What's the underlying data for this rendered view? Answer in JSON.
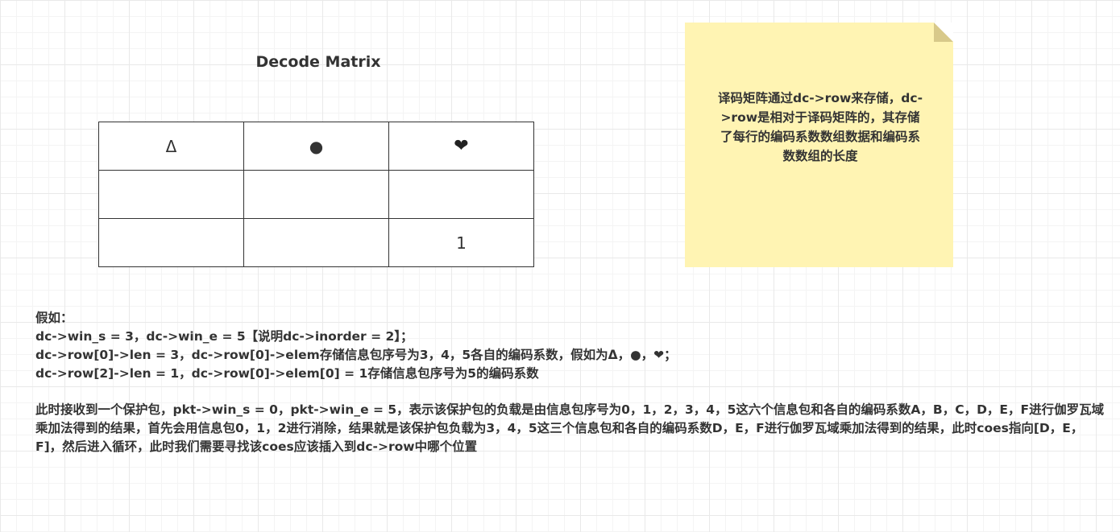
{
  "title": "Decode Matrix",
  "matrix": {
    "rows": [
      [
        "Δ",
        "●",
        "❤"
      ],
      [
        "",
        "",
        ""
      ],
      [
        "",
        "",
        "1"
      ]
    ]
  },
  "note": {
    "text": "译码矩阵通过dc->row来存储，dc->row是相对于译码矩阵的，其存储了每行的编码系数数组数据和编码系数数组的长度"
  },
  "body": {
    "line1": "假如：",
    "line2": "dc->win_s = 3，dc->win_e = 5【说明dc->inorder = 2】；",
    "line3": "dc->row[0]->len = 3，dc->row[0]->elem存储信息包序号为3，4，5各自的编码系数，假如为Δ，●，❤；",
    "line4": "dc->row[2]->len = 1，dc->row[0]->elem[0] = 1存储信息包序号为5的编码系数",
    "para": "此时接收到一个保护包，pkt->win_s = 0，pkt->win_e = 5，表示该保护包的负载是由信息包序号为0，1，2，3，4，5这六个信息包和各自的编码系数A，B，C，D，E，F进行伽罗瓦域乘加法得到的结果，首先会用信息包0，1，2进行消除，结果就是该保护包负载为3，4，5这三个信息包和各自的编码系数D，E，F进行伽罗瓦域乘加法得到的结果，此时coes指向[D，E，F]，然后进入循环，此时我们需要寻找该coes应该插入到dc->row中哪个位置"
  }
}
